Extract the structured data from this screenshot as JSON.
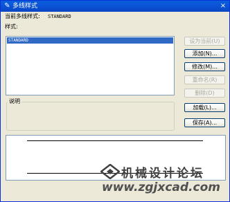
{
  "window": {
    "title": "多线样式",
    "close_glyph": "×",
    "icon_glyph": "✎"
  },
  "current_style": {
    "label": "当前多线样式:",
    "value": "STANDARD"
  },
  "styles_label": "样式:",
  "styles_list": {
    "items": [
      "STANDARD"
    ],
    "selected": "STANDARD"
  },
  "description": {
    "label": "说明"
  },
  "buttons": {
    "set_current": "设为当前(U)",
    "add": "添加(N)...",
    "modify": "修改(M)...",
    "rename": "重命名(R)",
    "delete": "删除(D)",
    "load": "加载(L)...",
    "save": "保存(A)..."
  },
  "watermark": {
    "text": "机械设计论坛",
    "url": "www.zgjxcad.com"
  },
  "colors": {
    "titlebar": "#0a5fdc",
    "selection": "#316ac5",
    "dialog_bg": "#ece9d8"
  }
}
